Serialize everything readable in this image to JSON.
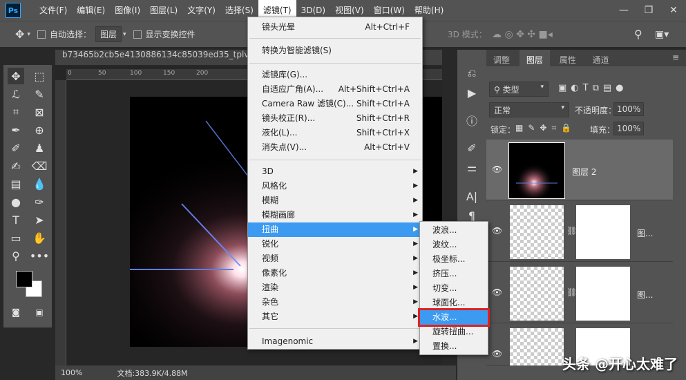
{
  "menubar": {
    "logo": "Ps",
    "items": [
      "文件(F)",
      "编辑(E)",
      "图像(I)",
      "图层(L)",
      "文字(Y)",
      "选择(S)",
      "滤镜(T)",
      "3D(D)",
      "视图(V)",
      "窗口(W)",
      "帮助(H)"
    ],
    "active_index": 6
  },
  "options": {
    "auto_select_label": "自动选择：",
    "layer_select": "图层",
    "show_transform_label": "显示变换控件",
    "mode_3d_label": "3D 模式："
  },
  "document": {
    "tab_title": "b73465b2cb5e4130886134c85039ed35_tplv-obj...",
    "ruler_ticks": [
      "0",
      "50",
      "100",
      "150",
      "200"
    ],
    "zoom": "100%",
    "doc_info": "文档:383.9K/4.88M"
  },
  "filter_menu": {
    "items": [
      {
        "label": "镜头光晕",
        "shortcut": "Alt+Ctrl+F"
      },
      {
        "label": "转换为智能滤镜(S)",
        "shortcut": ""
      },
      {
        "label": "滤镜库(G)...",
        "shortcut": ""
      },
      {
        "label": "自适应广角(A)...",
        "shortcut": "Alt+Shift+Ctrl+A"
      },
      {
        "label": "Camera Raw 滤镜(C)...",
        "shortcut": "Shift+Ctrl+A"
      },
      {
        "label": "镜头校正(R)...",
        "shortcut": "Shift+Ctrl+R"
      },
      {
        "label": "液化(L)...",
        "shortcut": "Shift+Ctrl+X"
      },
      {
        "label": "消失点(V)...",
        "shortcut": "Alt+Ctrl+V"
      },
      {
        "label": "3D",
        "shortcut": ""
      },
      {
        "label": "风格化",
        "shortcut": ""
      },
      {
        "label": "模糊",
        "shortcut": ""
      },
      {
        "label": "模糊画廊",
        "shortcut": ""
      },
      {
        "label": "扭曲",
        "shortcut": ""
      },
      {
        "label": "锐化",
        "shortcut": ""
      },
      {
        "label": "视频",
        "shortcut": ""
      },
      {
        "label": "像素化",
        "shortcut": ""
      },
      {
        "label": "渲染",
        "shortcut": ""
      },
      {
        "label": "杂色",
        "shortcut": ""
      },
      {
        "label": "其它",
        "shortcut": ""
      },
      {
        "label": "Imagenomic",
        "shortcut": ""
      }
    ]
  },
  "distort_menu": {
    "items": [
      "波浪...",
      "波纹...",
      "极坐标...",
      "挤压...",
      "切变...",
      "球面化...",
      "水波...",
      "旋转扭曲...",
      "置换..."
    ],
    "highlighted": "水波..."
  },
  "layers_panel": {
    "tabs": [
      "调整",
      "图层",
      "属性",
      "通道"
    ],
    "active_tab": "图层",
    "filter_kind": "类型",
    "blend_mode": "正常",
    "opacity_label": "不透明度：",
    "opacity_value": "100%",
    "lock_label": "锁定：",
    "fill_label": "填充：",
    "fill_value": "100%",
    "layers": [
      {
        "name": "图层 2"
      },
      {
        "name": "图..."
      },
      {
        "name": "图..."
      },
      {
        "name": ""
      }
    ]
  },
  "watermark": "头条 @开心太难了"
}
